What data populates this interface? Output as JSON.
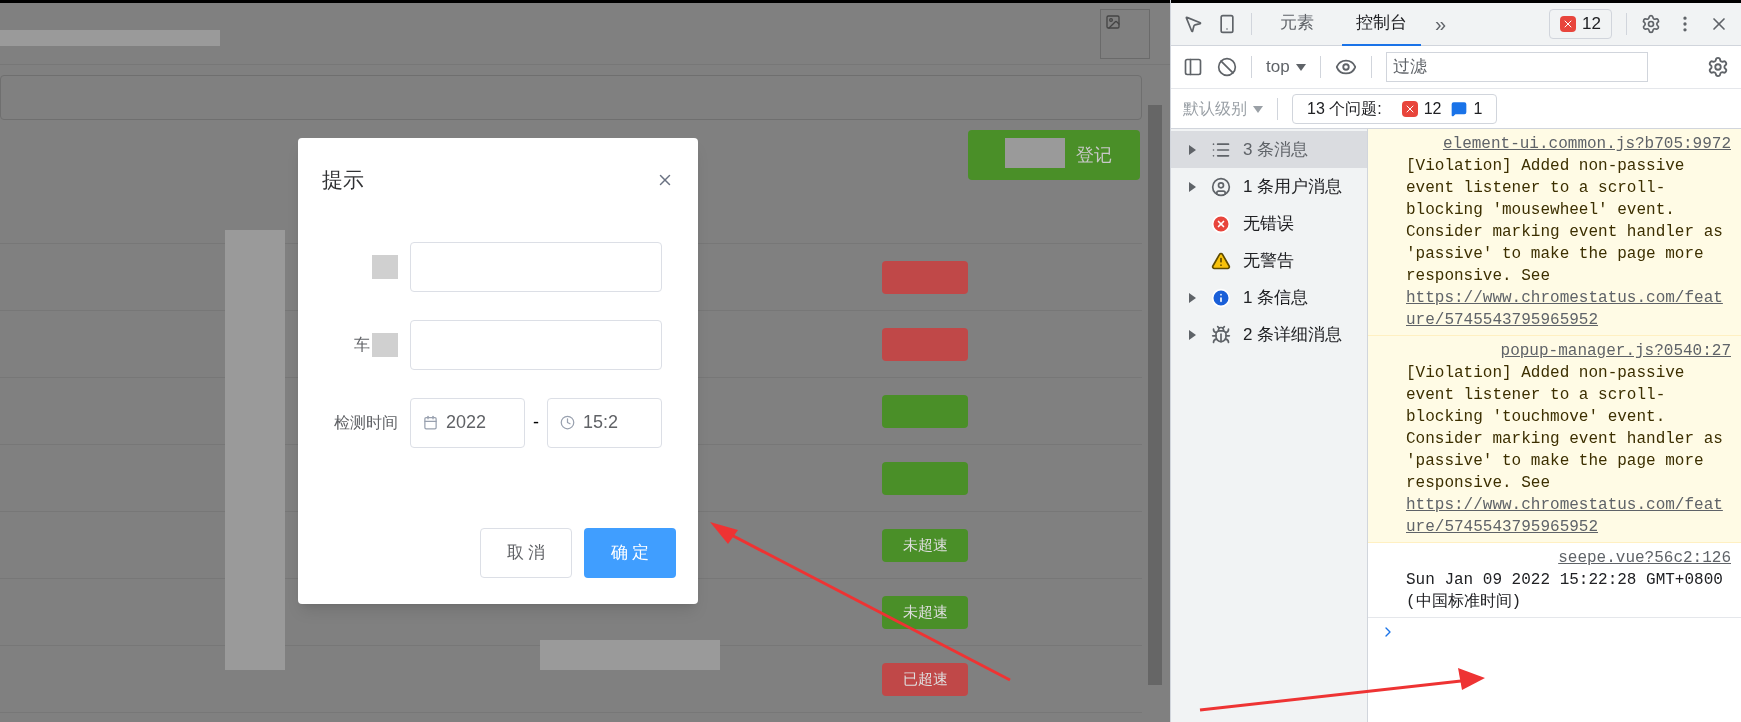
{
  "page": {
    "add_button": {
      "label": "登记"
    },
    "table": {
      "rows": [
        {
          "color": "#c04848"
        },
        {
          "color": "#c04848"
        },
        {
          "color": "#4a8f28"
        },
        {
          "color": "#4a8f28"
        },
        {
          "color": "#4a8f28",
          "tag": "未超速"
        },
        {
          "color": "#4a8f28",
          "tag": "未超速"
        },
        {
          "color": "#c04848",
          "tag": "已超速"
        }
      ]
    },
    "dialog": {
      "title": "提示",
      "fields": [
        {
          "kind": "text"
        },
        {
          "kind": "text",
          "label": "车"
        },
        {
          "kind": "datetime",
          "label": "检测时间",
          "date": "2022",
          "separator": "-",
          "time": "15:2"
        }
      ],
      "buttons": [
        {
          "kind": "cancel",
          "label": "取 消"
        },
        {
          "kind": "primary",
          "label": "确 定"
        }
      ]
    }
  },
  "devtools": {
    "tabs": [
      {
        "label": "元素",
        "selected": false
      },
      {
        "label": "控制台",
        "selected": true
      }
    ],
    "more": "»",
    "error_count": "12",
    "context": "top",
    "filter": {
      "placeholder": "过滤"
    },
    "level": {
      "label": "默认级别",
      "disabled": true
    },
    "issues": {
      "label": "13 个问题:",
      "errors": "12",
      "infos": "1"
    },
    "sidebar": [
      {
        "kind": "list",
        "label": "3 条消息",
        "expandable": true,
        "selected": true
      },
      {
        "kind": "user",
        "label": "1 条用户消息",
        "expandable": true,
        "selected": false
      },
      {
        "kind": "error",
        "label": "无错误",
        "expandable": false,
        "selected": false
      },
      {
        "kind": "warning",
        "label": "无警告",
        "expandable": false,
        "selected": false
      },
      {
        "kind": "info",
        "label": "1 条信息",
        "expandable": true,
        "selected": false
      },
      {
        "kind": "verbose",
        "label": "2 条详细消息",
        "expandable": true,
        "selected": false
      }
    ],
    "messages": [
      {
        "kind": "violation",
        "source": "element-ui.common.js?b705:9972",
        "text": "[Violation] Added non-passive event listener to a scroll-blocking 'mousewheel' event. Consider marking event handler as 'passive' to make the page more responsive. See",
        "url": "https://www.chromestatus.com/feature/5745543795965952"
      },
      {
        "kind": "violation",
        "source": "popup-manager.js?0540:27",
        "text": "[Violation] Added non-passive event listener to a scroll-blocking 'touchmove' event. Consider marking event handler as 'passive' to make the page more responsive. See",
        "url": "https://www.chromestatus.com/feature/5745543795965952"
      },
      {
        "kind": "log",
        "source": "seepe.vue?56c2:126",
        "text": "Sun Jan 09 2022 15:22:28 GMT+0800 (中国标准时间)"
      }
    ]
  }
}
